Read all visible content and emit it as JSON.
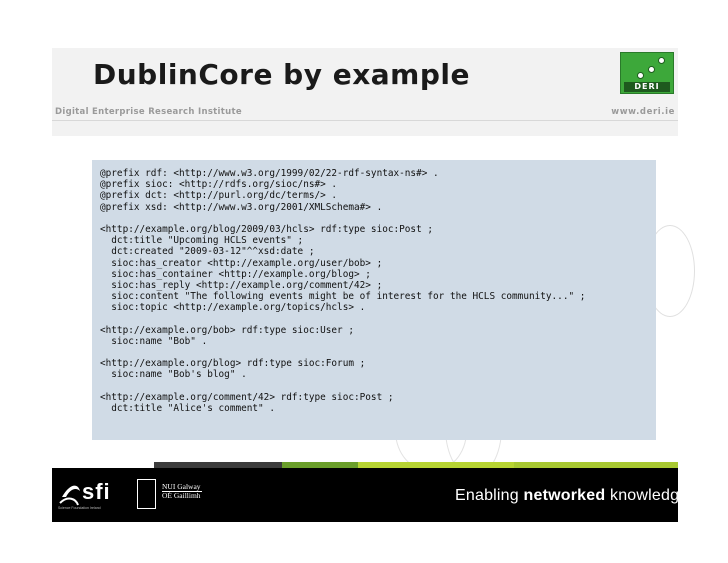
{
  "header": {
    "title": "DublinCore by example",
    "subtitle": "Digital Enterprise Research Institute",
    "site": "www.deri.ie"
  },
  "logo": {
    "text": "DERI",
    "icon": "deri-logo"
  },
  "code": {
    "lines": [
      "@prefix rdf: <http://www.w3.org/1999/02/22-rdf-syntax-ns#> .",
      "@prefix sioc: <http://rdfs.org/sioc/ns#> .",
      "@prefix dct: <http://purl.org/dc/terms/> .",
      "@prefix xsd: <http://www.w3.org/2001/XMLSchema#> .",
      "",
      "<http://example.org/blog/2009/03/hcls> rdf:type sioc:Post ;",
      "  dct:title \"Upcoming HCLS events\" ;",
      "  dct:created \"2009-03-12\"^^xsd:date ;",
      "  sioc:has_creator <http://example.org/user/bob> ;",
      "  sioc:has_container <http://example.org/blog> ;",
      "  sioc:has_reply <http://example.org/comment/42> ;",
      "  sioc:content \"The following events might be of interest for the HCLS community...\" ;",
      "  sioc:topic <http://example.org/topics/hcls> .",
      "",
      "<http://example.org/bob> rdf:type sioc:User ;",
      "  sioc:name \"Bob\" .",
      "",
      "<http://example.org/blog> rdf:type sioc:Forum ;",
      "  sioc:name \"Bob's blog\" .",
      "",
      "<http://example.org/comment/42> rdf:type sioc:Post ;",
      "  dct:title \"Alice's comment\" ."
    ]
  },
  "footer": {
    "tagline_pre": "Enabling ",
    "tagline_bold": "networked",
    "tagline_post": " knowledge.",
    "sfi": "sfi",
    "sfi_small": "Science Foundation Ireland",
    "nui_line1": "NUI Galway",
    "nui_line2": "OÉ Gaillimh",
    "stripe_colors": [
      "#ffffff",
      "#3c3c3c",
      "#6a9e2a",
      "#b7d433",
      "#a8c832"
    ]
  }
}
